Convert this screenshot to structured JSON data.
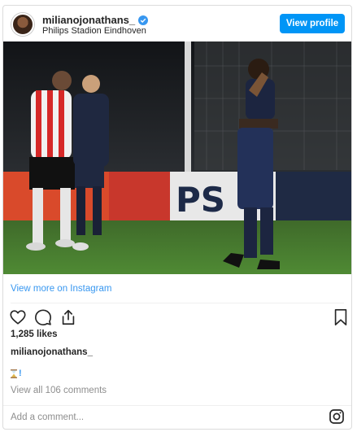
{
  "header": {
    "username": "milianojonathans_",
    "location": "Philips Stadion Eindhoven",
    "view_profile_label": "View profile"
  },
  "post": {
    "view_more_label": "View more on Instagram",
    "likes": "1,285 likes",
    "caption_user": "milianojonathans_",
    "caption_mark": "!",
    "comments_link": "View all 106 comments",
    "add_comment_placeholder": "Add a comment..."
  },
  "icons": {
    "verified": "verified-badge-icon",
    "like": "heart-icon",
    "comment": "comment-icon",
    "share": "share-icon",
    "save": "bookmark-icon",
    "instagram": "instagram-logo-icon",
    "hourglass": "hourglass-icon"
  },
  "colors": {
    "accent": "#0095f6",
    "link": "#3897f0",
    "muted": "#8e8e8e"
  }
}
